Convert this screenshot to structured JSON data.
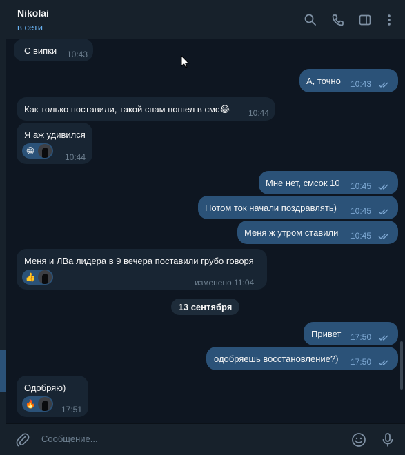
{
  "header": {
    "contact_name": "Nikolai",
    "status": "в сети"
  },
  "icons": {
    "search": "search-icon",
    "call": "phone-icon",
    "sidebar": "sidebar-toggle-icon",
    "more": "more-vert-icon",
    "attach": "paperclip-icon",
    "emoji": "smile-icon",
    "mic": "microphone-icon"
  },
  "colors": {
    "background": "#0e1621",
    "incoming_bubble": "#182533",
    "outgoing_bubble": "#2b5278",
    "accent": "#6ab3f3"
  },
  "messages": [
    {
      "dir": "in",
      "text": "С випки",
      "time": "10:43"
    },
    {
      "dir": "out",
      "text": "А, точно",
      "time": "10:43",
      "read": true
    },
    {
      "dir": "in",
      "text": "Как только поставили, такой спам пошел в смс",
      "emoji": "😂",
      "time": "10:44"
    },
    {
      "dir": "in",
      "text": "Я аж удивился",
      "time": "10:44",
      "reaction": "😁"
    },
    {
      "dir": "out",
      "text": "Мне нет, смсок 10",
      "time": "10:45",
      "read": true
    },
    {
      "dir": "out",
      "text": "Потом ток начали поздравлять)",
      "time": "10:45",
      "read": true
    },
    {
      "dir": "out",
      "text": "Меня ж утром ставили",
      "time": "10:45",
      "read": true
    },
    {
      "dir": "in",
      "text": "Меня и ЛВа лидера в 9 вечера поставили грубо говоря",
      "time": "изменено 11:04",
      "reaction": "👍"
    },
    {
      "dir": "out",
      "text": "Привет",
      "time": "17:50",
      "read": true
    },
    {
      "dir": "out",
      "text": "одобряешь восстановление?)",
      "time": "17:50",
      "read": true
    },
    {
      "dir": "in",
      "text": "Одобряю)",
      "time": "17:51",
      "reaction": "🔥"
    }
  ],
  "date_separator": "13 сентября",
  "composer": {
    "placeholder": "Сообщение..."
  }
}
